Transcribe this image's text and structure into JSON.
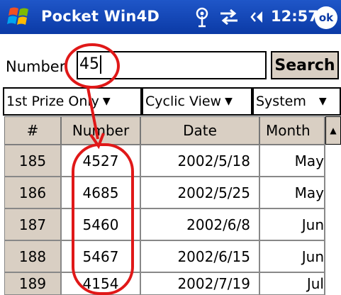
{
  "titlebar": {
    "title": "Pocket Win4D",
    "time": "12:57",
    "ok_label": "ok",
    "icons": [
      "windows-start-icon",
      "antenna-icon",
      "sync-icon",
      "volume-icon"
    ]
  },
  "search": {
    "label": "Number",
    "value": "45",
    "button_label": "Search"
  },
  "filters": {
    "prize": "1st Prize Only",
    "view": "Cyclic View",
    "system": "System"
  },
  "table": {
    "headers": [
      "#",
      "Number",
      "Date",
      "Month"
    ],
    "rows": [
      {
        "idx": "185",
        "number": "4527",
        "date": "2002/5/18",
        "month": "May"
      },
      {
        "idx": "186",
        "number": "4685",
        "date": "2002/5/25",
        "month": "May"
      },
      {
        "idx": "187",
        "number": "5460",
        "date": "2002/6/8",
        "month": "Jun"
      },
      {
        "idx": "188",
        "number": "5467",
        "date": "2002/6/15",
        "month": "Jun"
      },
      {
        "idx": "189",
        "number": "4154",
        "date": "2002/7/19",
        "month": "Jul"
      }
    ]
  },
  "colors": {
    "titlebar": "#0b3aa6",
    "header_bg": "#d9cfc3",
    "annotation": "#e01818"
  }
}
